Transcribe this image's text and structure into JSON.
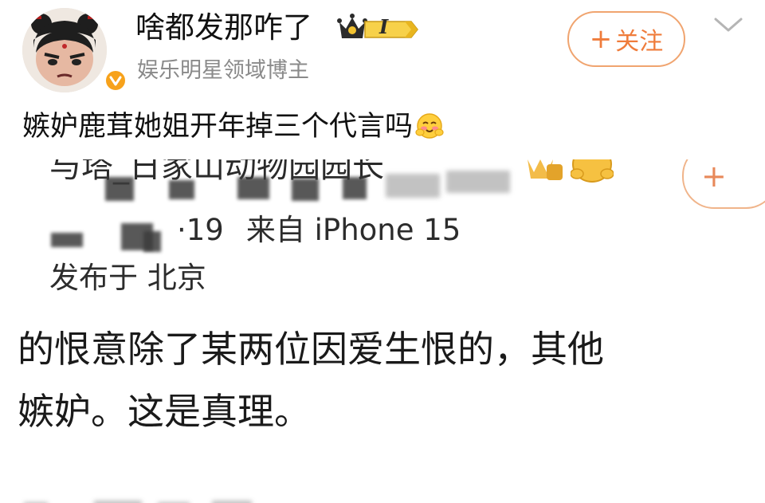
{
  "post": {
    "author": {
      "name": "啥都发那咋了",
      "vip_level": "I",
      "account_type": "娱乐明星领域博主",
      "avatar_icon": "cartoon-avatar-icon"
    },
    "follow_label": "关注",
    "follow_plus": "+",
    "text": "嫉妒鹿茸她姐开年掉三个代言吗",
    "emoji": "blush-emoji"
  },
  "embedded_screenshot": {
    "top_line_fragment": "与塔_日家山动物园园长",
    "inner_follow_plus": "+",
    "meta_time_fragment": "·19",
    "meta_source": "来自 iPhone 15",
    "location": "发布于 北京",
    "quote_line_1": "\u0000的恨意除了某两位因爱生恨的，其他",
    "quote_line_2": "\u0000嫉妒。这是真理。"
  },
  "colors": {
    "accent": "#ef7c3b",
    "follow_border": "#f0a46f",
    "verified": "#f7a21b",
    "secondary_text": "#8a8a8a"
  }
}
